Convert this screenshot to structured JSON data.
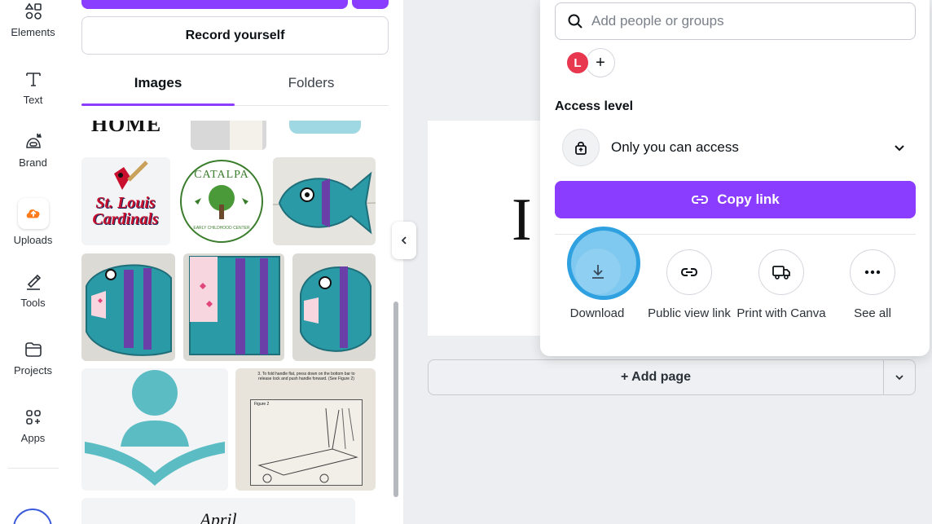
{
  "rail": {
    "items": [
      {
        "label": "Elements",
        "icon": "elements-icon"
      },
      {
        "label": "Text",
        "icon": "text-icon"
      },
      {
        "label": "Brand",
        "icon": "brand-icon"
      },
      {
        "label": "Uploads",
        "icon": "uploads-icon"
      },
      {
        "label": "Tools",
        "icon": "tools-icon"
      },
      {
        "label": "Projects",
        "icon": "projects-icon"
      },
      {
        "label": "Apps",
        "icon": "apps-icon"
      }
    ],
    "active": "Uploads"
  },
  "panel": {
    "record_label": "Record yourself",
    "tabs": [
      {
        "label": "Images"
      },
      {
        "label": "Folders"
      }
    ],
    "active_tab": "Images",
    "thumbs": {
      "catalpa": "CATALPA",
      "catalpa_sub": "EARLY CHILDHOOD CENTER",
      "cardinals": "St. Louis Cardinals",
      "instructions": "3. To fold handle flat, press down on the bottom bar to release lock and push handle forward. (See Figure 2)",
      "figure": "Figure 2",
      "home": "HOME",
      "april": "April"
    }
  },
  "canvas": {
    "page_letter": "I",
    "add_page": "+ Add page"
  },
  "share": {
    "search_placeholder": "Add people or groups",
    "avatar_initial": "L",
    "add_symbol": "+",
    "access_label": "Access level",
    "access_value": "Only you can access",
    "copy_link": "Copy link",
    "actions": [
      {
        "label": "Download",
        "icon": "download-icon"
      },
      {
        "label": "Public view link",
        "icon": "link-icon"
      },
      {
        "label": "Print with Canva",
        "icon": "print-truck-icon"
      },
      {
        "label": "See all",
        "icon": "more-icon"
      }
    ]
  },
  "colors": {
    "accent": "#8b3dff",
    "highlight": "#2fa0e0",
    "teal": "#5bbcc4"
  }
}
